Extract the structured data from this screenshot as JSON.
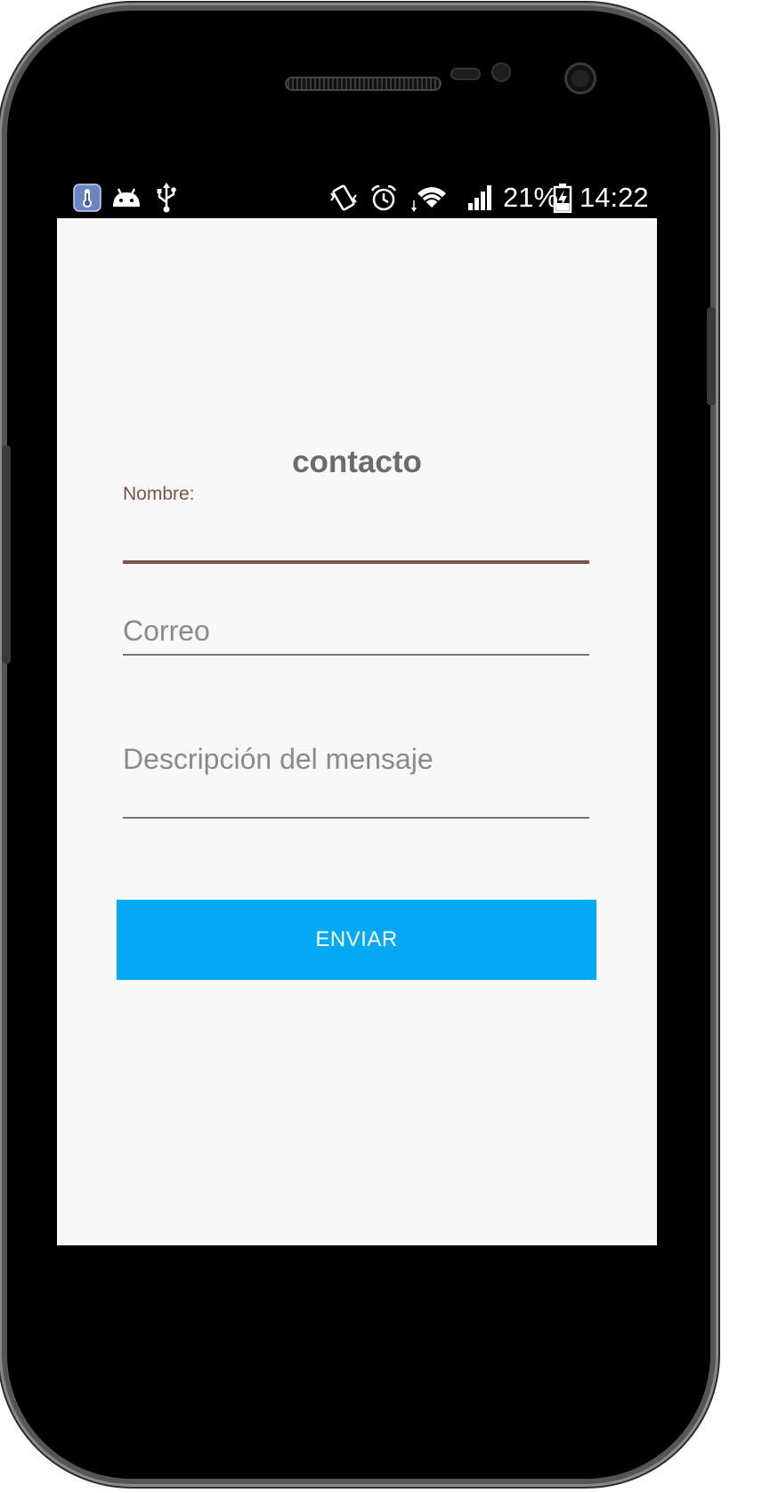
{
  "status_bar": {
    "left_icons": [
      "thermometer-app-icon",
      "android-icon",
      "usb-icon"
    ],
    "right_icons": [
      "vibrate-icon",
      "alarm-icon",
      "wifi-icon",
      "signal-icon",
      "battery-charging-icon"
    ],
    "battery_percent": "21%",
    "time": "14:22"
  },
  "form": {
    "title": "contacto",
    "name_label": "Nombre:",
    "name_value": "",
    "email_placeholder": "Correo",
    "message_placeholder": "Descripción del mensaje",
    "submit_label": "ENVIAR"
  },
  "colors": {
    "accent": "#795548",
    "button": "#03a9f4",
    "background": "#f8f8f8",
    "title": "#6b6b6b"
  }
}
